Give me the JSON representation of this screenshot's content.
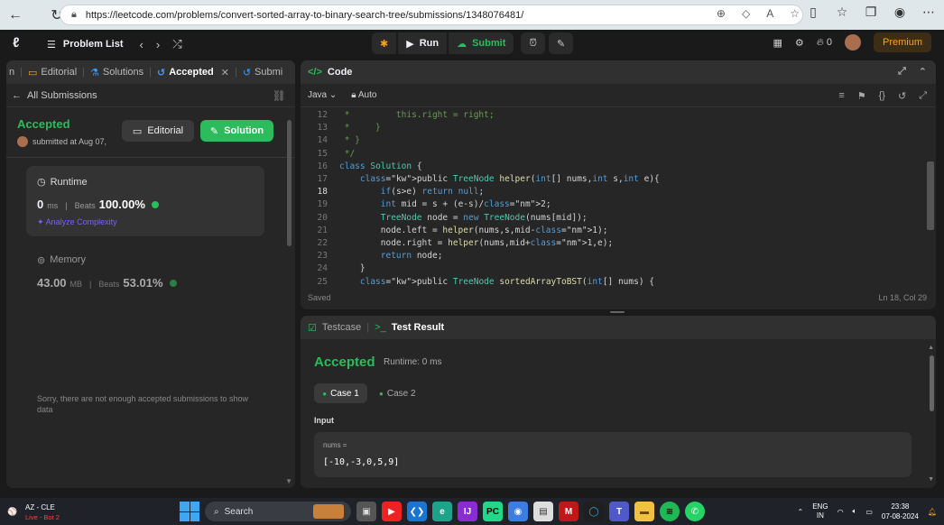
{
  "browser": {
    "url": "https://leetcode.com/problems/convert-sorted-array-to-binary-search-tree/submissions/1348076481/"
  },
  "topnav": {
    "problem_list": "Problem List",
    "run": "Run",
    "submit": "Submit",
    "streak": "0",
    "premium": "Premium"
  },
  "left": {
    "tabs": [
      {
        "label": "Editorial"
      },
      {
        "label": "Solutions"
      },
      {
        "label": "Accepted"
      },
      {
        "label": "Submi"
      }
    ],
    "all_submissions": "All Submissions",
    "status": "Accepted",
    "submitted_at": "submitted at Aug 07,",
    "editorial_btn": "Editorial",
    "solution_btn": "Solution",
    "runtime": {
      "label": "Runtime",
      "value": "0",
      "unit": "ms",
      "beats_label": "Beats",
      "beats": "100.00%",
      "analyze": "Analyze Complexity"
    },
    "memory": {
      "label": "Memory",
      "value": "43.00",
      "unit": "MB",
      "beats_label": "Beats",
      "beats": "53.01%"
    },
    "notice": "Sorry, there are not enough accepted submissions to show data"
  },
  "code": {
    "title": "Code",
    "language": "Java",
    "mode": "Auto",
    "status": "Saved",
    "cursor": "Ln 18, Col 29",
    "lines": [
      {
        "n": "12",
        "text": " *         this.right = right;"
      },
      {
        "n": "13",
        "text": " *     }"
      },
      {
        "n": "14",
        "text": " * }"
      },
      {
        "n": "15",
        "text": " */"
      },
      {
        "n": "16",
        "text": "class Solution {"
      },
      {
        "n": "17",
        "text": "    public TreeNode helper(int[] nums,int s,int e){"
      },
      {
        "n": "18",
        "text": "        if(s>e) return null;"
      },
      {
        "n": "19",
        "text": "        int mid = s + (e-s)/2;"
      },
      {
        "n": "20",
        "text": "        TreeNode node = new TreeNode(nums[mid]);"
      },
      {
        "n": "21",
        "text": "        node.left = helper(nums,s,mid-1);"
      },
      {
        "n": "22",
        "text": "        node.right = helper(nums,mid+1,e);"
      },
      {
        "n": "23",
        "text": "        return node;"
      },
      {
        "n": "24",
        "text": "    }"
      },
      {
        "n": "25",
        "text": "    public TreeNode sortedArrayToBST(int[] nums) {"
      }
    ]
  },
  "test": {
    "tab_testcase": "Testcase",
    "tab_result": "Test Result",
    "status": "Accepted",
    "runtime": "Runtime: 0 ms",
    "case1": "Case 1",
    "case2": "Case 2",
    "input_label": "Input",
    "param": "nums =",
    "value": "[-10,-3,0,5,9]"
  },
  "taskbar": {
    "weather_title": "AZ - CLE",
    "weather_sub": "Live - Bot 2",
    "search": "Search",
    "lang1": "ENG",
    "lang2": "IN",
    "time": "23:38",
    "date": "07-08-2024"
  },
  "colors": {
    "accent_green": "#2cbb5d",
    "premium_orange": "#ffa116",
    "panel_bg": "#262626"
  }
}
